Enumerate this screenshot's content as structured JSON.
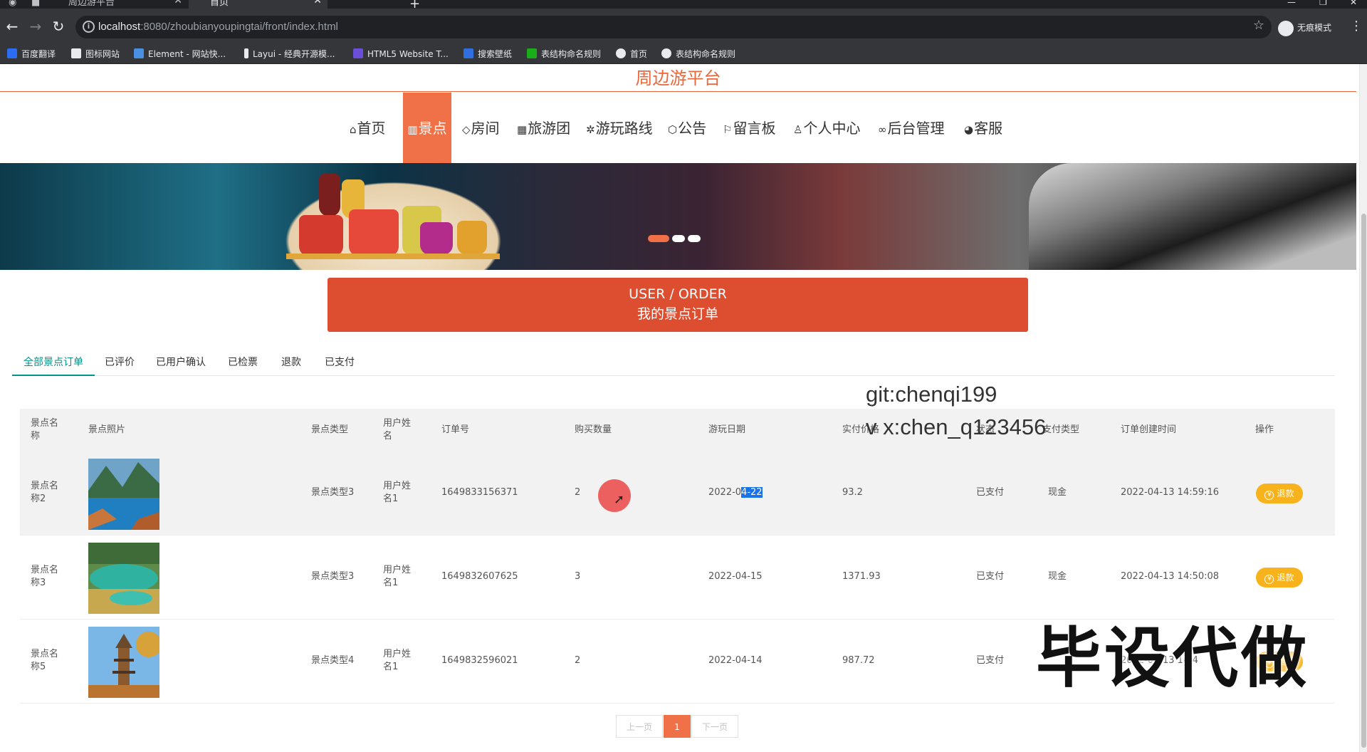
{
  "browser": {
    "tabs": [
      {
        "label": "周边游平台",
        "active": false
      },
      {
        "label": "首页",
        "active": true
      }
    ],
    "address": {
      "host": "localhost",
      "path": ":8080/zhoubianyoupingtai/front/index.html"
    },
    "profile_label": "无痕模式",
    "bookmarks": [
      {
        "label": "百度翻译",
        "color": "#2b6cf3"
      },
      {
        "label": "图标网站",
        "color": "#e8eaed"
      },
      {
        "label": "Element - 网站快...",
        "color": "#4a90e2"
      },
      {
        "label": "Layui - 经典开源模...",
        "color": "#e8eaed"
      },
      {
        "label": "HTML5 Website T...",
        "color": "#6b4fd8"
      },
      {
        "label": "搜索壁纸",
        "color": "#2f6fe0"
      },
      {
        "label": "表结构命名规则",
        "color": "#1aad19"
      },
      {
        "label": "首页",
        "color": "#e8eaed"
      },
      {
        "label": "表结构命名规则",
        "color": "#e8eaed"
      }
    ]
  },
  "site": {
    "title": "周边游平台",
    "accent": "#f07147",
    "nav": [
      {
        "icon": "home-icon",
        "glyph": "⌂",
        "label": "首页",
        "active": false
      },
      {
        "icon": "map-icon",
        "glyph": "▥",
        "label": "景点",
        "active": true
      },
      {
        "icon": "tag-icon",
        "glyph": "◇",
        "label": "房间",
        "active": false
      },
      {
        "icon": "calendar-icon",
        "glyph": "▦",
        "label": "旅游团",
        "active": false
      },
      {
        "icon": "gear-icon",
        "glyph": "✲",
        "label": "游玩路线",
        "active": false
      },
      {
        "icon": "cube-icon",
        "glyph": "⬡",
        "label": "公告",
        "active": false
      },
      {
        "icon": "flag-icon",
        "glyph": "⚐",
        "label": "留言板",
        "active": false
      },
      {
        "icon": "user-icon",
        "glyph": "♙",
        "label": "个人中心",
        "active": false
      },
      {
        "icon": "link-icon",
        "glyph": "∞",
        "label": "后台管理",
        "active": false
      },
      {
        "icon": "chat-icon",
        "glyph": "◕",
        "label": "客服",
        "active": false
      }
    ]
  },
  "order_banner": {
    "line1": "USER / ORDER",
    "line2": "我的景点订单"
  },
  "subtabs": [
    {
      "label": "全部景点订单",
      "active": true
    },
    {
      "label": "已评价",
      "active": false
    },
    {
      "label": "已用户确认",
      "active": false
    },
    {
      "label": "已检票",
      "active": false
    },
    {
      "label": "退款",
      "active": false
    },
    {
      "label": "已支付",
      "active": false
    }
  ],
  "watermark": {
    "line1": "git:chenqi199",
    "line2": "v x:chen_q123456",
    "promo": "毕设代做"
  },
  "table": {
    "headers": [
      "景点名称",
      "景点照片",
      "景点类型",
      "用户姓名",
      "订单号",
      "购买数量",
      "游玩日期",
      "实付价格",
      "状态",
      "支付类型",
      "订单创建时间",
      "操作"
    ],
    "rows": [
      {
        "name": "景点名称2",
        "type": "景点类型3",
        "user": "用户姓名1",
        "order_no": "1649833156371",
        "qty": "2",
        "date_prefix": "2022-0",
        "date_selected": "4-22",
        "price": "93.2",
        "status": "已支付",
        "pay": "现金",
        "created": "2022-04-13 14:59:16",
        "action": "退款",
        "photo": "lake"
      },
      {
        "name": "景点名称3",
        "type": "景点类型3",
        "user": "用户姓名1",
        "order_no": "1649832607625",
        "qty": "3",
        "date_prefix": "2022-04-15",
        "date_selected": "",
        "price": "1371.93",
        "status": "已支付",
        "pay": "现金",
        "created": "2022-04-13 14:50:08",
        "action": "退款",
        "photo": "pool"
      },
      {
        "name": "景点名称5",
        "type": "景点类型4",
        "user": "用户姓名1",
        "order_no": "1649832596021",
        "qty": "2",
        "date_prefix": "2022-04-14",
        "date_selected": "",
        "price": "987.72",
        "status": "已支付",
        "pay": "",
        "created": "2022-04-13 14:4",
        "action": "退款",
        "photo": "pagoda"
      }
    ]
  },
  "pagination": {
    "prev": "上一页",
    "current": "1",
    "next": "下一页"
  }
}
